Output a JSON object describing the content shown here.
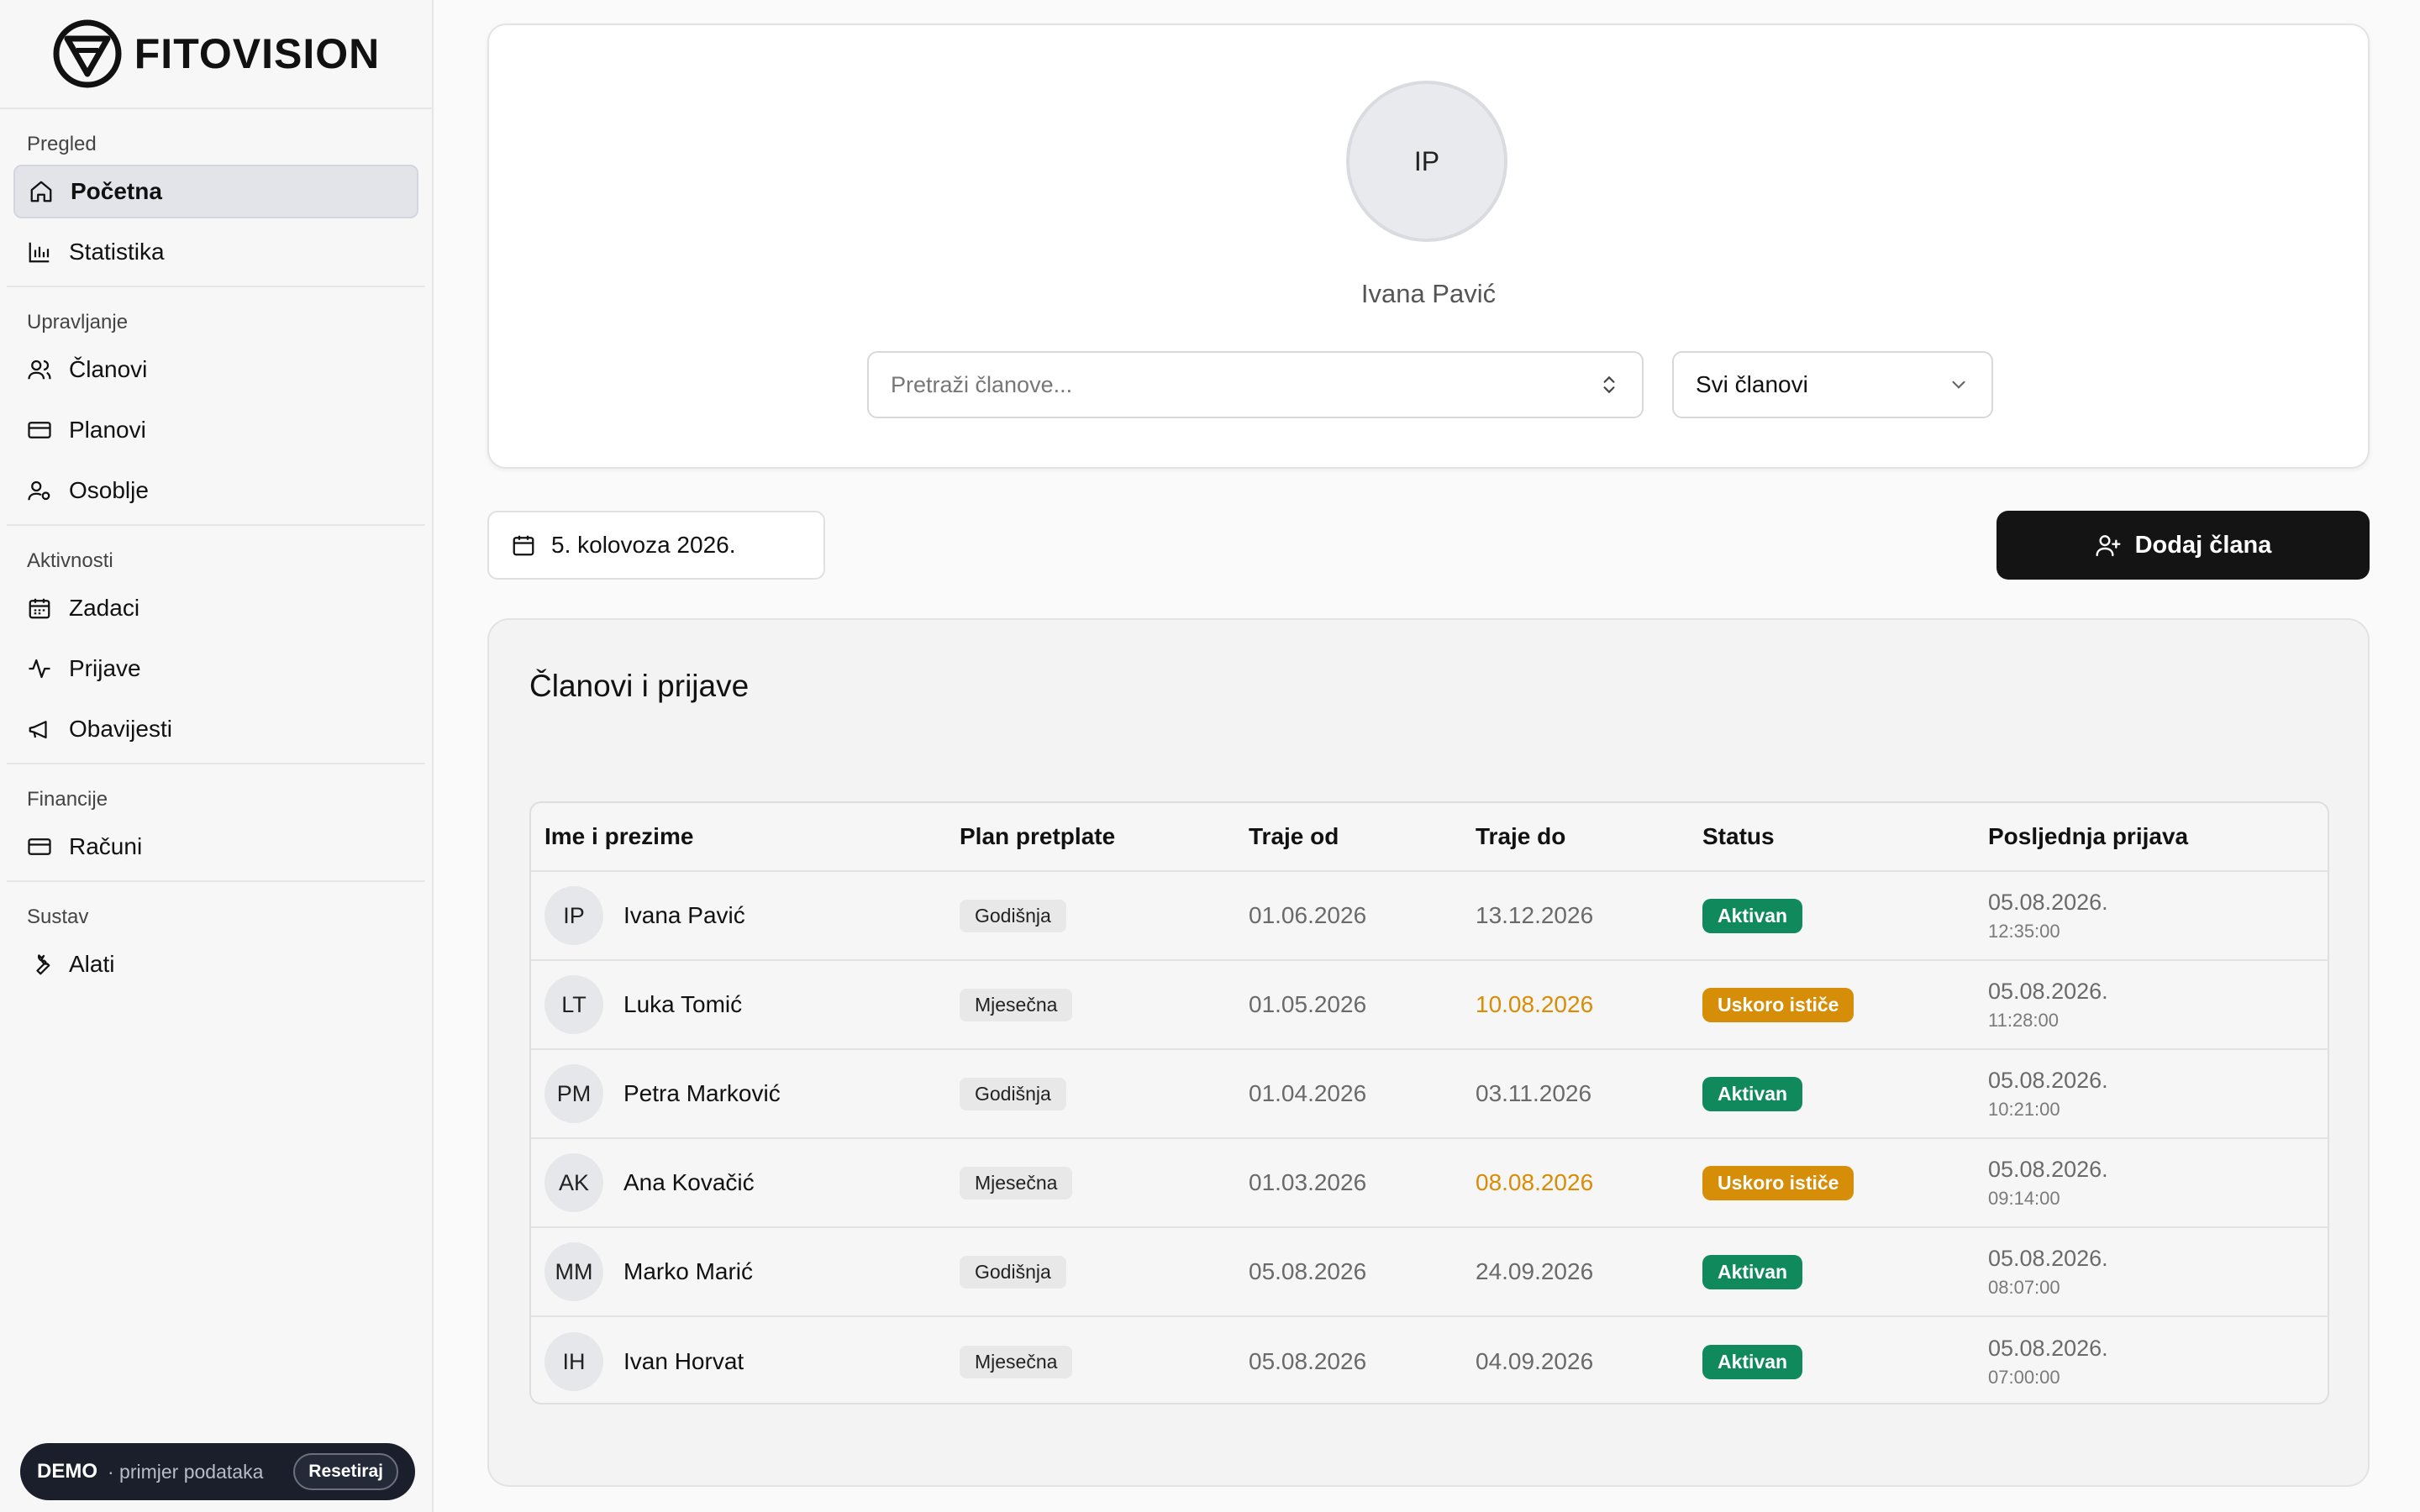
{
  "brand": {
    "name": "FITOVISION"
  },
  "sidebar": {
    "sections": [
      {
        "label": "Pregled",
        "items": [
          {
            "label": "Početna",
            "icon": "home-icon"
          },
          {
            "label": "Statistika",
            "icon": "bar-chart-icon"
          }
        ]
      },
      {
        "label": "Upravljanje",
        "items": [
          {
            "label": "Članovi",
            "icon": "users-icon"
          },
          {
            "label": "Planovi",
            "icon": "credit-card-icon"
          },
          {
            "label": "Osoblje",
            "icon": "staff-icon"
          }
        ]
      },
      {
        "label": "Aktivnosti",
        "items": [
          {
            "label": "Zadaci",
            "icon": "calendar-icon"
          },
          {
            "label": "Prijave",
            "icon": "activity-icon"
          },
          {
            "label": "Obavijesti",
            "icon": "megaphone-icon"
          }
        ]
      },
      {
        "label": "Financije",
        "items": [
          {
            "label": "Računi",
            "icon": "credit-card-icon"
          }
        ]
      },
      {
        "label": "Sustav",
        "items": [
          {
            "label": "Alati",
            "icon": "wrench-icon"
          }
        ]
      }
    ]
  },
  "demo": {
    "title": "DEMO",
    "subtitle": "· primjer podataka",
    "reset_label": "Resetiraj"
  },
  "profile": {
    "initials": "IP",
    "name": "Ivana Pavić"
  },
  "search": {
    "placeholder": "Pretraži članove..."
  },
  "filter": {
    "selected": "Svi članovi"
  },
  "date": {
    "label": "5. kolovoza 2026."
  },
  "add_member": {
    "label": "Dodaj člana"
  },
  "table": {
    "title": "Članovi i prijave",
    "headers": [
      "Ime i prezime",
      "Plan pretplate",
      "Traje od",
      "Traje do",
      "Status",
      "Posljednja prijava"
    ],
    "rows": [
      {
        "initials": "IP",
        "name": "Ivana Pavić",
        "plan": "Godišnja",
        "from": "01.06.2026",
        "to": "13.12.2026",
        "status": "Aktivan",
        "last_date": "05.08.2026.",
        "last_time": "12:35:00"
      },
      {
        "initials": "LT",
        "name": "Luka Tomić",
        "plan": "Mjesečna",
        "from": "01.05.2026",
        "to": "10.08.2026",
        "status": "Uskoro ističe",
        "last_date": "05.08.2026.",
        "last_time": "11:28:00"
      },
      {
        "initials": "PM",
        "name": "Petra Marković",
        "plan": "Godišnja",
        "from": "01.04.2026",
        "to": "03.11.2026",
        "status": "Aktivan",
        "last_date": "05.08.2026.",
        "last_time": "10:21:00"
      },
      {
        "initials": "AK",
        "name": "Ana Kovačić",
        "plan": "Mjesečna",
        "from": "01.03.2026",
        "to": "08.08.2026",
        "status": "Uskoro ističe",
        "last_date": "05.08.2026.",
        "last_time": "09:14:00"
      },
      {
        "initials": "MM",
        "name": "Marko Marić",
        "plan": "Godišnja",
        "from": "05.08.2026",
        "to": "24.09.2026",
        "status": "Aktivan",
        "last_date": "05.08.2026.",
        "last_time": "08:07:00"
      },
      {
        "initials": "IH",
        "name": "Ivan Horvat",
        "plan": "Mjesečna",
        "from": "05.08.2026",
        "to": "04.09.2026",
        "status": "Aktivan",
        "last_date": "05.08.2026.",
        "last_time": "07:00:00"
      }
    ]
  },
  "colors": {
    "active": "#108a5c",
    "expiring": "#d68d07",
    "primary_button": "#141414"
  }
}
